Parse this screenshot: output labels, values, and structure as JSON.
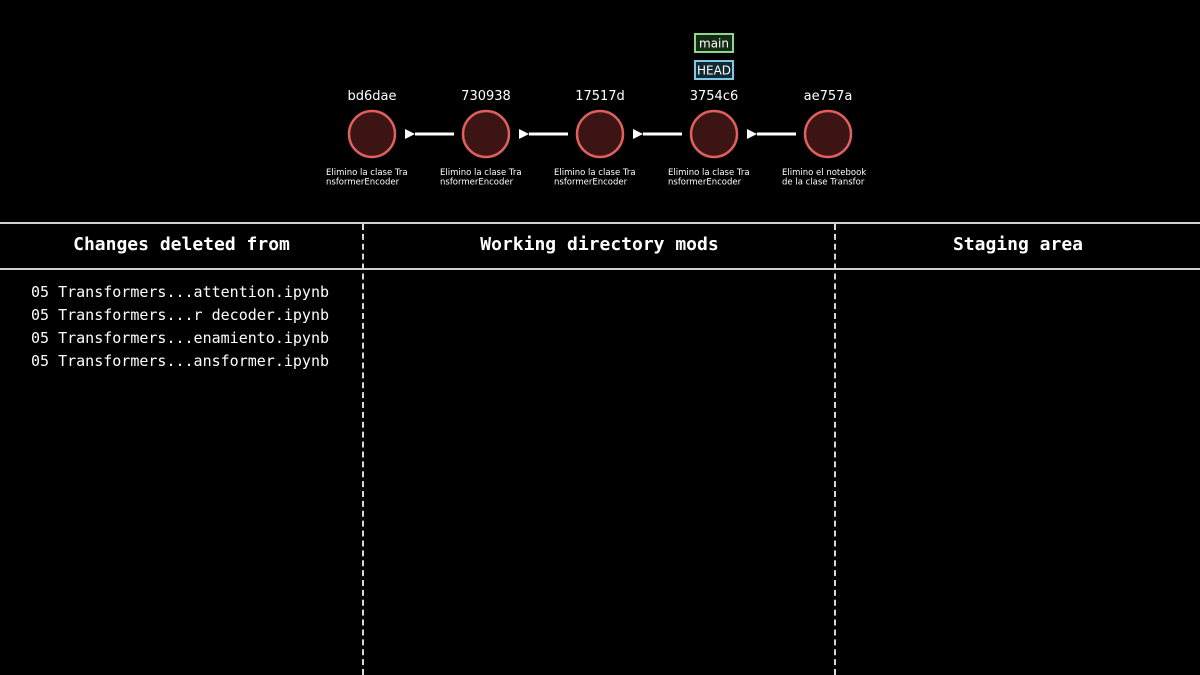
{
  "commits": [
    {
      "hash": "bd6dae",
      "message_lines": [
        "Elimino la clase Tra",
        "nsformerEncoder"
      ]
    },
    {
      "hash": "730938",
      "message_lines": [
        "Elimino la clase Tra",
        "nsformerEncoder"
      ]
    },
    {
      "hash": "17517d",
      "message_lines": [
        "Elimino la clase Tra",
        "nsformerEncoder"
      ]
    },
    {
      "hash": "3754c6",
      "message_lines": [
        "Elimino la clase Tra",
        "nsformerEncoder"
      ],
      "refs": [
        {
          "label": "main",
          "color": "#8fd48f",
          "fill": "#132a13"
        },
        {
          "label": "HEAD",
          "color": "#7ec8e3",
          "fill": "#0f2a33"
        }
      ]
    },
    {
      "hash": "ae757a",
      "message_lines": [
        "Elimino el notebook",
        "de la clase Transfor"
      ]
    }
  ],
  "colors": {
    "commit_stroke": "#e06060",
    "commit_fill": "#3d1414",
    "arrow": "#ffffff"
  },
  "columns": {
    "deleted": {
      "header": "Changes deleted from",
      "files": [
        "05 Transformers...attention.ipynb",
        "05 Transformers...r decoder.ipynb",
        "05 Transformers...enamiento.ipynb",
        "05 Transformers...ansformer.ipynb"
      ]
    },
    "working": {
      "header": "Working directory mods",
      "files": []
    },
    "staging": {
      "header": "Staging area",
      "files": []
    }
  }
}
